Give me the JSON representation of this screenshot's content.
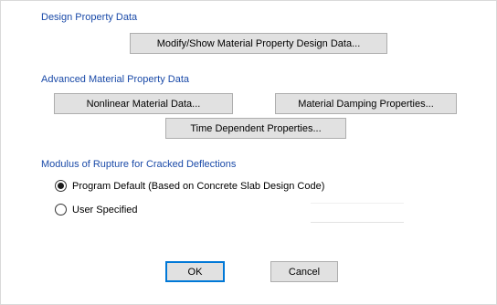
{
  "design": {
    "title": "Design Property Data",
    "modify_button": "Modify/Show Material Property Design Data..."
  },
  "advanced": {
    "title": "Advanced Material Property Data",
    "nonlinear_button": "Nonlinear Material Data...",
    "damping_button": "Material Damping Properties...",
    "time_button": "Time Dependent Properties..."
  },
  "rupture": {
    "title": "Modulus of Rupture for Cracked Deflections",
    "options": [
      {
        "label": "Program Default  (Based on Concrete Slab Design Code)",
        "selected": true
      },
      {
        "label": "User Specified",
        "selected": false
      }
    ],
    "value": ""
  },
  "footer": {
    "ok_label": "OK",
    "cancel_label": "Cancel"
  }
}
